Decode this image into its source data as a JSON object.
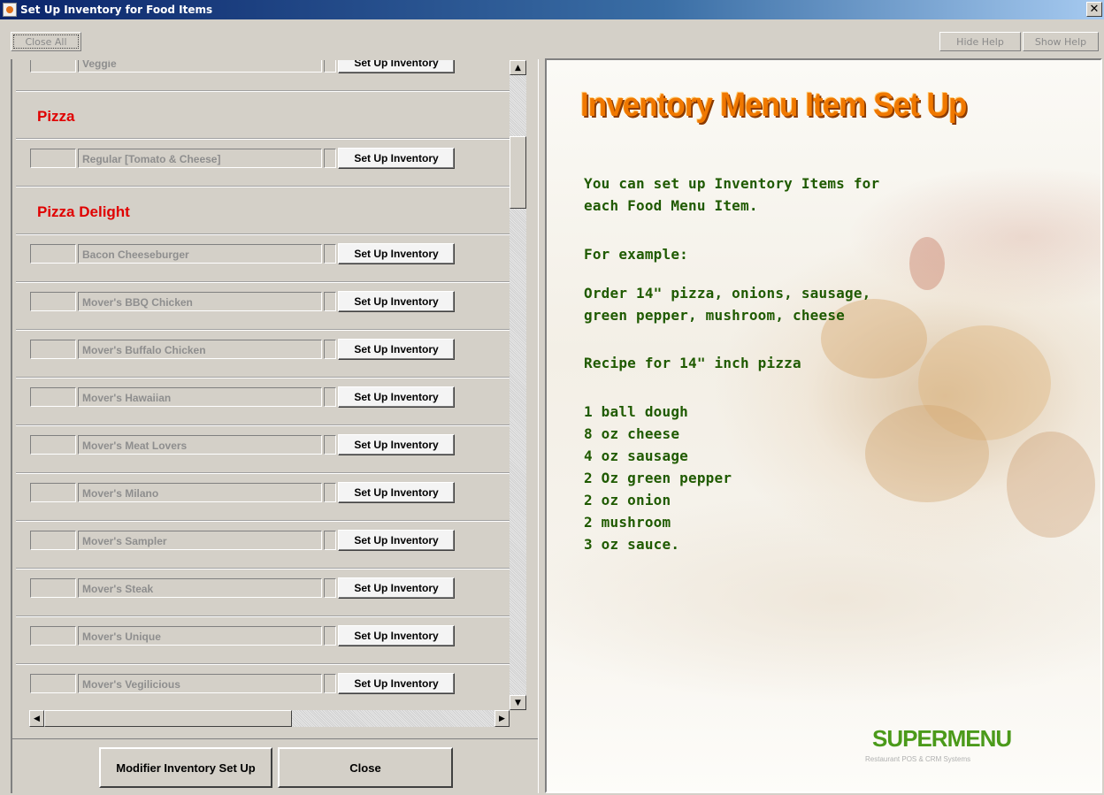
{
  "window": {
    "title": "Set Up Inventory for Food Items",
    "close_glyph": "✕"
  },
  "toolbar": {
    "close_all": "Close All",
    "hide_help": "Hide Help",
    "show_help": "Show Help"
  },
  "list": {
    "setup_label": "Set Up Inventory",
    "rows": [
      {
        "kind": "item",
        "name": "Veggie"
      },
      {
        "kind": "category",
        "name": "Pizza"
      },
      {
        "kind": "item",
        "name": "Regular [Tomato & Cheese]"
      },
      {
        "kind": "category",
        "name": "Pizza Delight"
      },
      {
        "kind": "item",
        "name": "Bacon Cheeseburger"
      },
      {
        "kind": "item",
        "name": "Mover's BBQ Chicken"
      },
      {
        "kind": "item",
        "name": "Mover's Buffalo Chicken"
      },
      {
        "kind": "item",
        "name": "Mover's Hawaiian"
      },
      {
        "kind": "item",
        "name": "Mover's Meat Lovers"
      },
      {
        "kind": "item",
        "name": "Mover's Milano"
      },
      {
        "kind": "item",
        "name": "Mover's Sampler"
      },
      {
        "kind": "item",
        "name": "Mover's Steak"
      },
      {
        "kind": "item",
        "name": "Mover's Unique"
      },
      {
        "kind": "item",
        "name": "Mover's Vegilicious"
      }
    ]
  },
  "scrollbar": {
    "up": "▲",
    "down": "▼",
    "left": "◀",
    "right": "▶"
  },
  "buttons": {
    "modifier": "Modifier Inventory Set Up",
    "close": "Close"
  },
  "help": {
    "title": "Inventory Menu Item Set Up",
    "lines": [
      "You can set up Inventory Items for",
      "each Food Menu Item.",
      "For example:",
      "Order 14\" pizza, onions, sausage,",
      "green pepper, mushroom, cheese",
      "Recipe for 14\" inch pizza",
      "1 ball dough",
      "8 oz cheese",
      "4 oz sausage",
      "2 Oz green pepper",
      "2 oz onion",
      "2 mushroom",
      "3 oz sauce."
    ],
    "logo": "SUPERMENU",
    "logo_sub": "Restaurant POS & CRM Systems"
  }
}
